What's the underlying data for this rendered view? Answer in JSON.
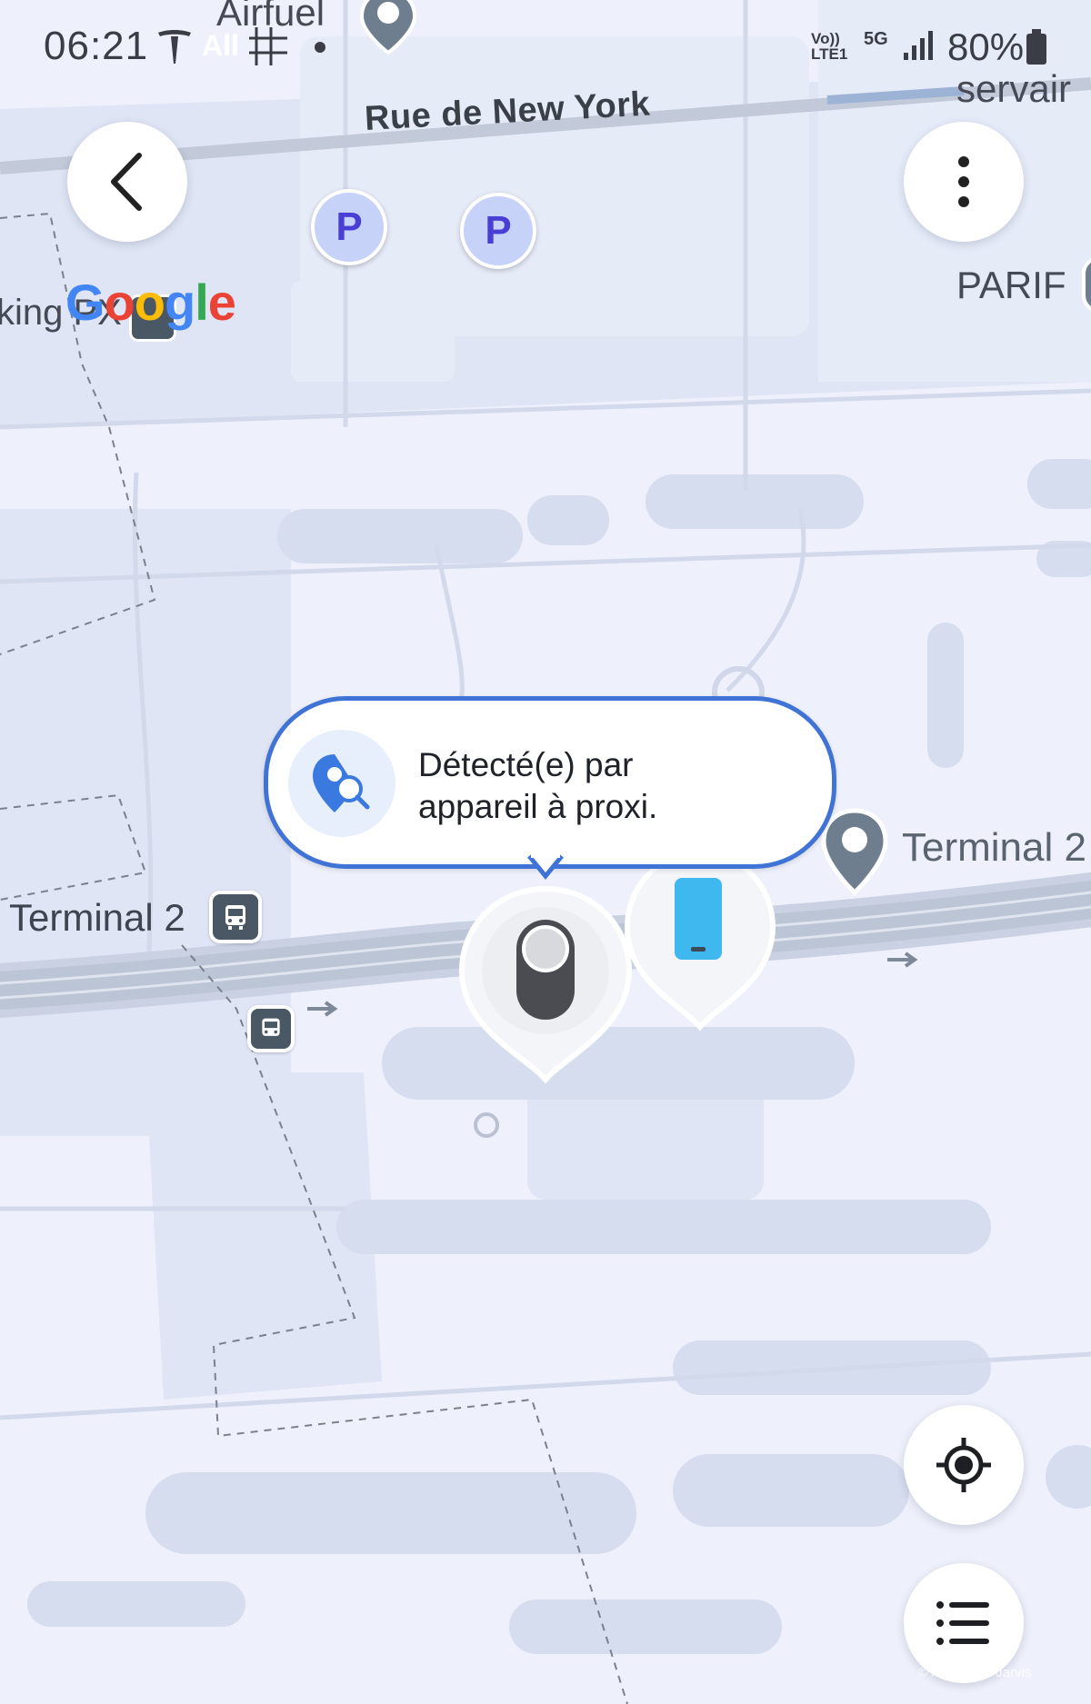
{
  "status_bar": {
    "time": "06:21",
    "carrier_badge": "All",
    "network_volte": "Vo)) LTE1",
    "network_5g": "5G",
    "battery_percent": "80%"
  },
  "map": {
    "street_name": "Rue de New York",
    "poi_airfuel": "Airfuel",
    "poi_servair": "servair",
    "poi_parif": "PARIF",
    "poi_parking": "king PX",
    "poi_terminal2_right": "Terminal 2",
    "label_terminal2_left": "Terminal 2",
    "parking_letter": "P",
    "google_letters": [
      "G",
      "o",
      "o",
      "g",
      "l",
      "e"
    ],
    "google_colors": [
      "#4285F4",
      "#EA4335",
      "#FBBC05",
      "#4285F4",
      "#34A853",
      "#EA4335"
    ]
  },
  "popup": {
    "line1": "Détecté(e) par",
    "line2": "appareil à proxi.",
    "icon": "location-search-icon"
  },
  "markers": {
    "tag_icon": "smarttag-icon",
    "phone_icon": "phone-icon"
  },
  "controls": {
    "back_icon": "chevron-left-icon",
    "more_icon": "more-vert-icon",
    "locate_icon": "my-location-icon",
    "list_icon": "list-icon"
  },
  "attribution": "© Aéroport · Jarvis",
  "colors": {
    "map_background": "#eef1fb",
    "road": "#bcc5d6",
    "accent_blue": "#3f74d6",
    "parking_fill": "#c6d2f7",
    "parking_text": "#4a3fd4",
    "phone_blue": "#3fb8f0"
  }
}
